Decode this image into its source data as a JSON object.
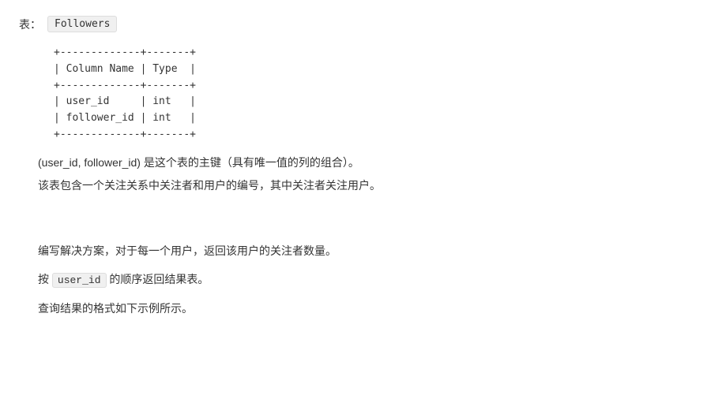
{
  "header": {
    "label": "表：",
    "table_name": "Followers"
  },
  "schema": {
    "line1": "+-------------+-------+",
    "line2": "| Column Name | Type  |",
    "line3": "+-------------+-------+",
    "line4": "| user_id     | int   |",
    "line5": "| follower_id | int   |",
    "line6": "+-------------+-------+"
  },
  "description": {
    "primary_key": "(user_id, follower_id) 是这个表的主键（具有唯一值的列的组合）。",
    "details": "该表包含一个关注关系中关注者和用户的编号，其中关注者关注用户。"
  },
  "instructions": {
    "task": "编写解决方案，对于每一个用户，返回该用户的关注者数量。",
    "order": "按",
    "order_col": "user_id",
    "order_suffix": "的顺序返回结果表。",
    "format": "查询结果的格式如下示例所示。"
  }
}
